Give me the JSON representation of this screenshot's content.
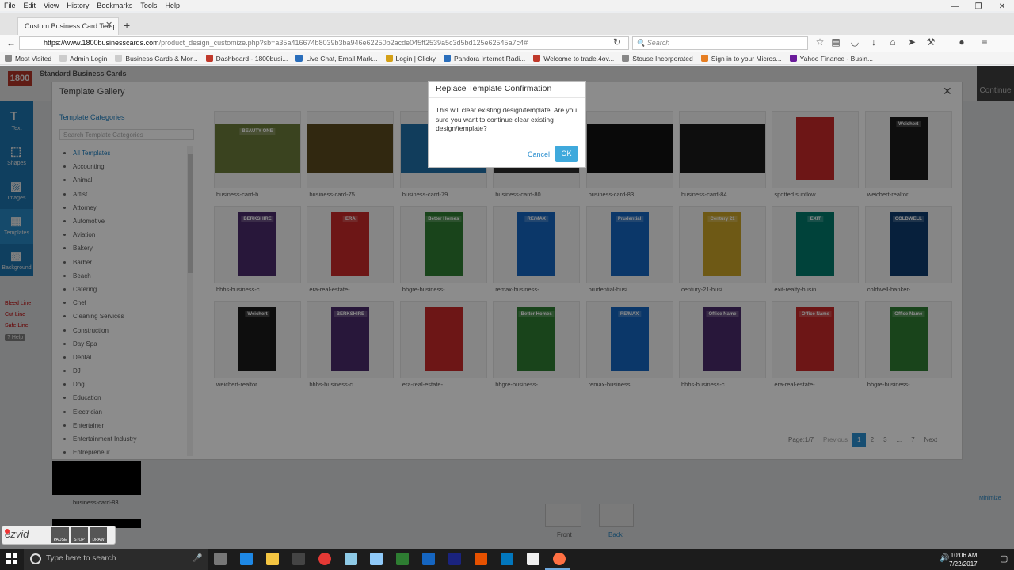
{
  "menu": [
    "File",
    "Edit",
    "View",
    "History",
    "Bookmarks",
    "Tools",
    "Help"
  ],
  "tab": {
    "title": "Custom Business Card Temp"
  },
  "url": {
    "host": "https://www.1800businesscards.com",
    "path": "/product_design_customize.php?sb=a35a416674b8039b3ba946e62250b2acde045ff2539a5c3d5bd125e62545a7c4#"
  },
  "search": {
    "placeholder": "Search"
  },
  "bookmarks": [
    {
      "label": "Most Visited",
      "color": "#888"
    },
    {
      "label": "Admin Login",
      "color": "#ccc"
    },
    {
      "label": "Business Cards & Mor...",
      "color": "#ccc"
    },
    {
      "label": "Dashboard - 1800busi...",
      "color": "#c0392b"
    },
    {
      "label": "Live Chat, Email Mark...",
      "color": "#2a6ebb"
    },
    {
      "label": "Login | Clicky",
      "color": "#d4a017"
    },
    {
      "label": "Pandora Internet Radi...",
      "color": "#2a6ebb"
    },
    {
      "label": "Welcome to trade.4ov...",
      "color": "#c0392b"
    },
    {
      "label": "Stouse Incorporated",
      "color": "#888"
    },
    {
      "label": "Sign in to your Micros...",
      "color": "#e67e22"
    },
    {
      "label": "Yahoo Finance - Busin...",
      "color": "#6a1b9a"
    }
  ],
  "app": {
    "logo": "1800",
    "title": "Standard Business Cards",
    "continue": "Continue"
  },
  "tools": [
    "Text",
    "Shapes",
    "Images",
    "Templates",
    "Background"
  ],
  "links": [
    "Bleed Line",
    "Cut Line",
    "Safe Line",
    "? Help"
  ],
  "gallery": {
    "title": "Template Gallery",
    "categories_heading": "Template Categories",
    "search_placeholder": "Search Template Categories",
    "categories": [
      "All Templates",
      "Accounting",
      "Animal",
      "Artist",
      "Attorney",
      "Automotive",
      "Aviation",
      "Bakery",
      "Barber",
      "Beach",
      "Catering",
      "Chef",
      "Cleaning Services",
      "Construction",
      "Day Spa",
      "Dental",
      "DJ",
      "Dog",
      "Education",
      "Electrician",
      "Entertainer",
      "Entertainment Industry",
      "Entrepreneur"
    ],
    "cards": [
      {
        "label": "business-card-b...",
        "bg": "#6b7a3a",
        "shape": "wide",
        "brand": "BEAUTY ONE"
      },
      {
        "label": "business-card-75",
        "bg": "#5a4a1e",
        "shape": "wide",
        "brand": ""
      },
      {
        "label": "business-card-79",
        "bg": "#1f6fa8",
        "shape": "wide",
        "brand": ""
      },
      {
        "label": "business-card-80",
        "bg": "#2a2a2a",
        "shape": "wide",
        "brand": ""
      },
      {
        "label": "business-card-83",
        "bg": "#111111",
        "shape": "wide",
        "brand": ""
      },
      {
        "label": "business-card-84",
        "bg": "#1a1a1a",
        "shape": "wide",
        "brand": ""
      },
      {
        "label": "spotted sunflow...",
        "bg": "#c62828",
        "shape": "tall",
        "brand": ""
      },
      {
        "label": "weichert-realtor...",
        "bg": "#1a1a1a",
        "shape": "tall",
        "brand": "Weichert"
      },
      {
        "label": "bhhs-business-c...",
        "bg": "#4a2a6a",
        "shape": "tall",
        "brand": "BERKSHIRE"
      },
      {
        "label": "era-real-estate-...",
        "bg": "#c62828",
        "shape": "tall",
        "brand": "ERA"
      },
      {
        "label": "bhgre-business-...",
        "bg": "#2e7d32",
        "shape": "tall",
        "brand": "Better Homes"
      },
      {
        "label": "remax-business-...",
        "bg": "#1565c0",
        "shape": "tall",
        "brand": "RE/MAX"
      },
      {
        "label": "prudential-busi...",
        "bg": "#1565c0",
        "shape": "tall",
        "brand": "Prudential"
      },
      {
        "label": "century-21-busi...",
        "bg": "#c9a227",
        "shape": "tall",
        "brand": "Century 21"
      },
      {
        "label": "exit-realty-busin...",
        "bg": "#00796b",
        "shape": "tall",
        "brand": "EXIT"
      },
      {
        "label": "coldwell-banker-...",
        "bg": "#0d3b6e",
        "shape": "tall",
        "brand": "COLDWELL"
      },
      {
        "label": "weichert-realtor...",
        "bg": "#1a1a1a",
        "shape": "tall",
        "brand": "Weichert"
      },
      {
        "label": "bhhs-business-c...",
        "bg": "#4a2a6a",
        "shape": "tall",
        "brand": "BERKSHIRE"
      },
      {
        "label": "era-real-estate-...",
        "bg": "#c62828",
        "shape": "tall",
        "brand": ""
      },
      {
        "label": "bhgre-business-...",
        "bg": "#2e7d32",
        "shape": "tall",
        "brand": "Better Homes"
      },
      {
        "label": "remax-business...",
        "bg": "#1565c0",
        "shape": "tall",
        "brand": "RE/MAX"
      },
      {
        "label": "bhhs-business-c...",
        "bg": "#4a2a6a",
        "shape": "tall",
        "brand": "Office Name"
      },
      {
        "label": "era-real-estate-...",
        "bg": "#c62828",
        "shape": "tall",
        "brand": "Office Name"
      },
      {
        "label": "bhgre-business-...",
        "bg": "#2e7d32",
        "shape": "tall",
        "brand": "Office Name"
      }
    ],
    "pager": {
      "label": "Page:1/7",
      "previous": "Previous",
      "pages": [
        "1",
        "2",
        "3",
        "...",
        "7"
      ],
      "next": "Next",
      "current": "1"
    }
  },
  "dialog": {
    "title": "Replace Template Confirmation",
    "message": "This will clear existing design/template. Are you sure you want to continue clear existing design/template?",
    "cancel": "Cancel",
    "ok": "OK"
  },
  "behind": {
    "card_label": "business-card-83",
    "front": "Front",
    "back": "Back",
    "minimize": "Minimize"
  },
  "recorder": {
    "brand": "ezvid",
    "buttons": [
      "PAUSE",
      "STOP",
      "DRAW"
    ]
  },
  "taskbar": {
    "search_placeholder": "Type here to search",
    "time": "10:06 AM",
    "date": "7/22/2017"
  }
}
